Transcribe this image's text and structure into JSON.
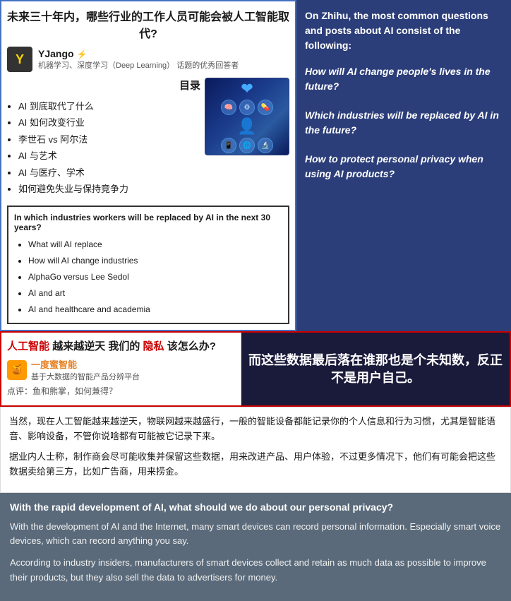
{
  "top": {
    "left": {
      "title": "未来三十年内，哪些行业的工作人员可能会被人工智能取代?",
      "author": {
        "avatar": "Y",
        "name": "YJango",
        "badge": "⚡",
        "desc": "机器学习、深度学习（Deep Learning） 话题的优秀回答者"
      },
      "toc": {
        "title": "目录",
        "items": [
          "AI 到底取代了什么",
          "AI 如何改变行业",
          "李世石 vs 阿尔法",
          "AI 与艺术",
          "AI 与医疗、学术",
          "如何避免失业与保持竞争力"
        ]
      },
      "translation": {
        "title": "In which industries workers will be replaced by AI in the next 30 years?",
        "items": [
          "What will AI replace",
          "How will AI change industries",
          "AlphaGo versus Lee Sedol",
          "AI and art",
          "AI and healthcare and academia"
        ]
      }
    },
    "right": {
      "intro": "On  Zhihu,  the  most common  questions  and posts  about  AI  consist  of the following:",
      "questions": [
        "How will AI change people's lives in the future?",
        "Which industries will be replaced by AI in the future?",
        "How to protect personal privacy when using AI products?"
      ]
    }
  },
  "middle": {
    "left": {
      "title_part1": "人工智能",
      "title_highlight1": "越来越逆天",
      "title_part2": " 我们的",
      "title_highlight2": "隐私",
      "title_part3": "该怎么办?",
      "platform_name": "一度蜜智能",
      "platform_desc": "基于大数据的智能产品分辨平台",
      "comment": "点评：鱼和熊掌，如何兼得？"
    },
    "right": {
      "quote": "而这些数据最后落在谁那也是个未知数，反正不是用户自己。"
    }
  },
  "content_cn": {
    "paragraph1": "当然，现在人工智能越来越逆天，物联网越来越盛行，一般的智能设备都能记录你的个人信息和行为习惯，尤其是智能语音、影响设备，不管你说啥都有可能被它记录下来。",
    "paragraph2": "据业内人士称，制作商会尽可能收集并保留这些数据，用来改进产品、用户体验，不过更多情况下，他们有可能会把这些数据卖给第三方，比如广告商，用来捞金。"
  },
  "english": {
    "title": "With the rapid development of AI, what should we do about our personal privacy?",
    "paragraph1": "With the development of AI and the Internet, many smart devices can record personal information. Especially smart voice devices, which can record anything you say.",
    "paragraph2": "According to industry insiders, manufacturers of smart devices collect and retain as much data as possible to improve their products, but they also sell the data to advertisers for money."
  }
}
